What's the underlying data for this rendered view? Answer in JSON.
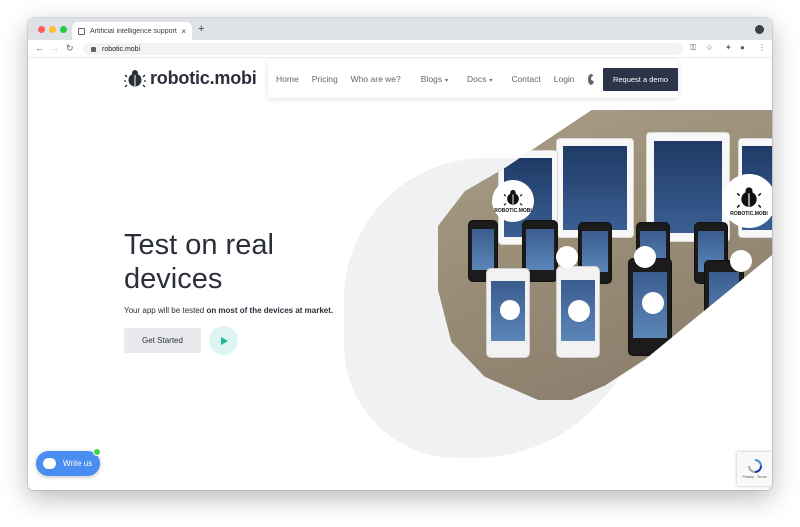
{
  "browser": {
    "tab_title": "Artificial intelligence supported",
    "tab_close": "×",
    "new_tab": "+",
    "url": "robotic.mobi",
    "nav_back": "←",
    "nav_forward": "→",
    "nav_reload": "↻",
    "icons": [
      "key-icon",
      "star-icon",
      "puzzle-icon",
      "profile-icon",
      "kebab-menu-icon"
    ]
  },
  "header": {
    "logo_text": "robotic.mobi",
    "nav": [
      {
        "label": "Home"
      },
      {
        "label": "Pricing"
      },
      {
        "label": "Who are we?"
      },
      {
        "label": "Blogs"
      },
      {
        "label": "Docs"
      },
      {
        "label": "Contact"
      },
      {
        "label": "Login"
      }
    ],
    "dropdown_caret": "▾",
    "cta_label": "Request a demo"
  },
  "hero": {
    "title": "Test on real devices",
    "subtitle_plain": "Your app will be tested ",
    "subtitle_bold": "on most of the devices at market.",
    "get_started": "Get Started"
  },
  "photo": {
    "badge_text": "ROBOTIC.MOBI"
  },
  "chat": {
    "label": "Write us"
  },
  "recaptcha": {
    "label": "Privacy - Terms"
  },
  "colors": {
    "brand_dark": "#2d3448",
    "accent_teal": "#1fb596",
    "chat_blue": "#4a8df0"
  }
}
